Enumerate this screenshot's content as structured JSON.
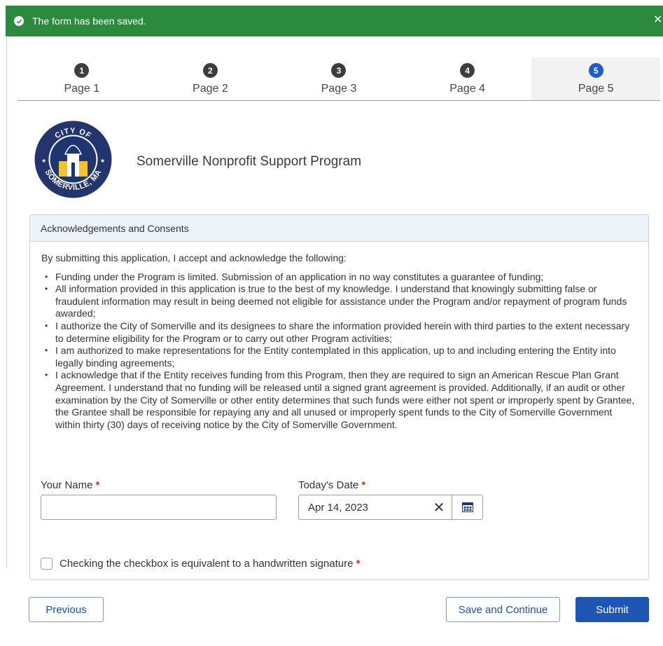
{
  "toast": {
    "message": "The form has been saved.",
    "close_glyph": "✕",
    "color": "#2b8a3e"
  },
  "steps": [
    {
      "number": "1",
      "label": "Page 1"
    },
    {
      "number": "2",
      "label": "Page 2"
    },
    {
      "number": "3",
      "label": "Page 3"
    },
    {
      "number": "4",
      "label": "Page 4"
    },
    {
      "number": "5",
      "label": "Page 5",
      "active": true
    }
  ],
  "logo": {
    "top_text": "CITY OF",
    "bottom_text": "SOMERVILLE, MA"
  },
  "program_title": "Somerville Nonprofit Support Program",
  "panel": {
    "title": "Acknowledgements and Consents",
    "intro": "By submitting this application, I accept and acknowledge the following:",
    "items": [
      "Funding under the Program is limited. Submission of an application in no way constitutes a guarantee of funding;",
      "All information provided in this application is true to the best of my knowledge. I understand that knowingly submitting false or fraudulent information may result in being deemed not eligible for assistance under the Program and/or repayment of program funds awarded;",
      "I authorize the City of Somerville and its designees to share the information provided herein with third parties to the extent necessary to determine eligibility for the Program or to carry out other Program activities;",
      "I am authorized to make representations for the Entity contemplated in this application, up to and including entering the Entity into legally binding agreements;",
      "I acknowledge that if the Entity receives funding from this Program, then they are required to sign an American Rescue Plan Grant Agreement.  I understand that no funding will be released until a signed grant agreement is provided.  Additionally, if an audit or other examination by the City of Somerville or other entity determines that such funds were either not spent or improperly spent by Grantee, the Grantee shall be responsible for repaying any and all unused or improperly spent funds to the City of Somerville Government within thirty (30) days of receiving notice by the City of Somerville Government."
    ]
  },
  "form": {
    "name_label": "Your Name",
    "name_value": "",
    "date_label": "Today's Date",
    "date_value": "Apr 14, 2023",
    "clear_glyph": "✕",
    "required_mark": "*",
    "signature_label": "Checking the checkbox is equivalent to a handwritten signature",
    "signature_checked": false
  },
  "buttons": {
    "previous": "Previous",
    "save_continue": "Save and Continue",
    "submit": "Submit"
  },
  "colors": {
    "primary": "#1f56b3",
    "active_step": "#1f5cc4",
    "required": "#c0392b"
  }
}
